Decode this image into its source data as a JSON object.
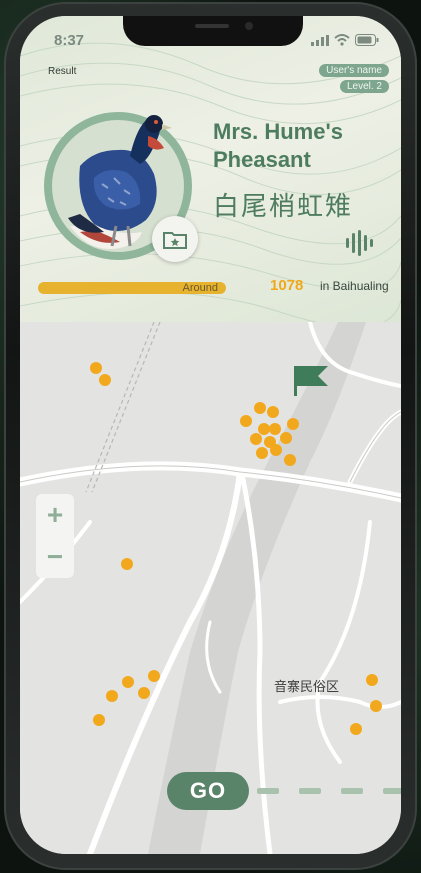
{
  "status_bar": {
    "time": "8:37"
  },
  "header": {
    "result_label": "Result",
    "user_name": "User's name",
    "level": "Level. 2",
    "bird_name_en_line1": "Mrs. Hume's",
    "bird_name_en_line2": "Pheasant",
    "bird_name_zh": "白尾梢虹雉",
    "progress_fraction": 1.0,
    "progress_label": "Around",
    "count": "1078",
    "count_suffix": "in Baihualing"
  },
  "map": {
    "zoom_in": "+",
    "zoom_out": "−",
    "place_label": "音寨民俗区",
    "go_label": "GO"
  },
  "colors": {
    "accent_green": "#4e7c5f",
    "sighting_dot": "#f2a81d",
    "progress": "#e7b22e"
  }
}
